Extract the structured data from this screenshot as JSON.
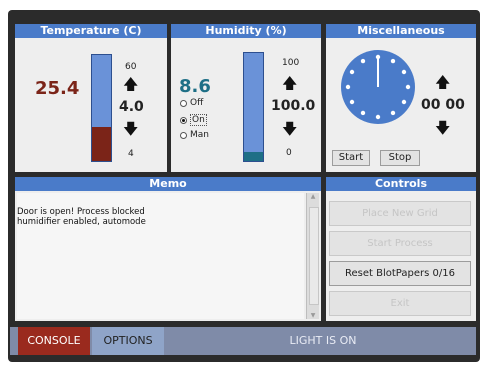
{
  "temperature": {
    "title": "Temperature (C)",
    "current": "25.4",
    "max": "60",
    "setpoint": "4.0",
    "min": "4",
    "level": 0.32
  },
  "humidity": {
    "title": "Humidity (%)",
    "current": "8.6",
    "max": "100",
    "setpoint": "100.0",
    "min": "0",
    "level": 0.086,
    "modes": [
      {
        "label": "Off",
        "selected": false
      },
      {
        "label": "On",
        "selected": true
      },
      {
        "label": "Man",
        "selected": false
      }
    ]
  },
  "misc": {
    "title": "Miscellaneous",
    "timer": "00 00",
    "start_label": "Start",
    "stop_label": "Stop"
  },
  "memo": {
    "title": "Memo",
    "lines": [
      "Door is open! Process blocked",
      "humidifier enabled, automode"
    ]
  },
  "controls": {
    "title": "Controls",
    "buttons": [
      "Place New Grid",
      "Start Process",
      "Reset BlotPapers 0/16",
      "Exit"
    ]
  },
  "footer": {
    "console_label": "CONSOLE",
    "options_label": "OPTIONS",
    "status": "LIGHT IS ON"
  },
  "colors": {
    "accent": "#4a7bc9",
    "temp_fill": "#7b2418",
    "hum_fill": "#1e6f86",
    "console": "#9a2a1e"
  },
  "icons": [
    "arrow-up-icon",
    "arrow-down-icon",
    "clock-icon"
  ]
}
